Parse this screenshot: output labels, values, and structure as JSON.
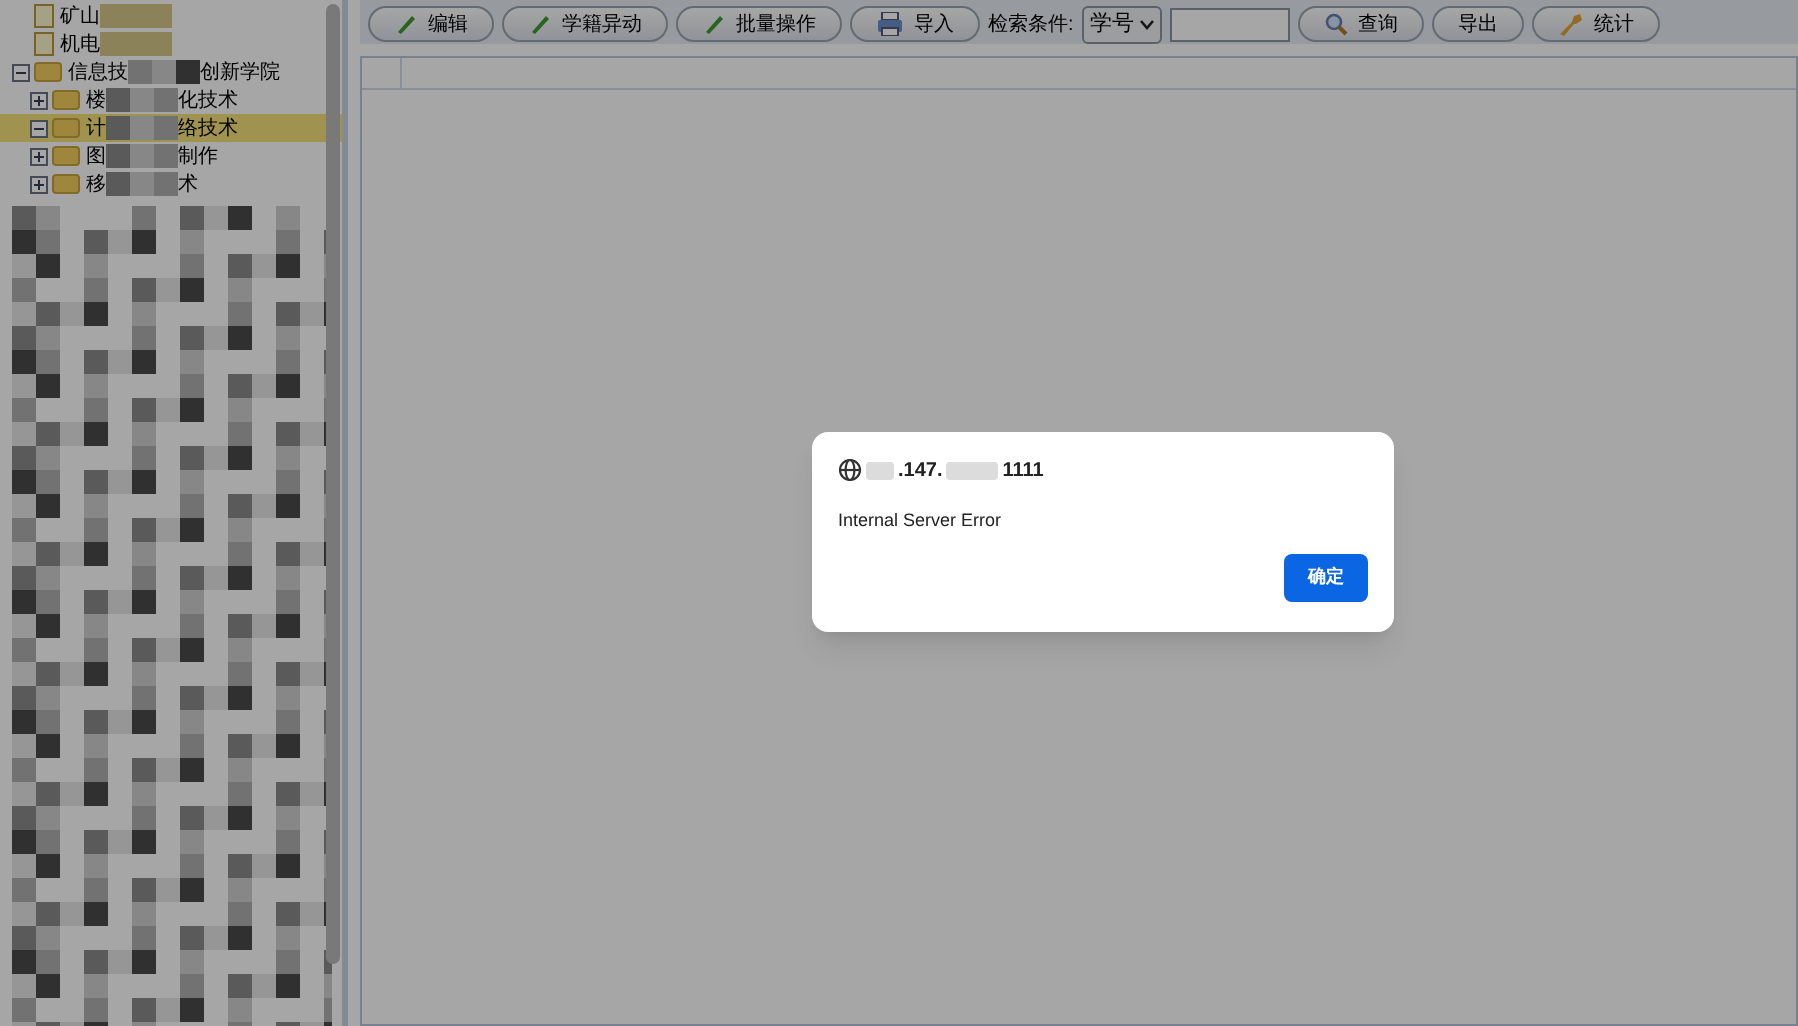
{
  "tree": [
    {
      "kind": "file",
      "parts": [
        "矿山"
      ]
    },
    {
      "kind": "file",
      "parts": [
        "机电"
      ]
    },
    {
      "kind": "folder",
      "parts": [
        "信息技",
        "创新学院"
      ],
      "expanded": true,
      "selected": false,
      "children": [
        {
          "kind": "folder",
          "parts": [
            "楼",
            "化技术"
          ],
          "expanded": false,
          "selected": false
        },
        {
          "kind": "folder",
          "parts": [
            "计",
            "络技术"
          ],
          "expanded": true,
          "selected": true
        },
        {
          "kind": "folder",
          "parts": [
            "图",
            "制作"
          ],
          "expanded": false,
          "selected": false
        },
        {
          "kind": "folder",
          "parts": [
            "移",
            "术"
          ],
          "expanded": false,
          "selected": false
        }
      ]
    }
  ],
  "toolbar": {
    "buttons_left": [
      {
        "kind": "pencil",
        "label": "编辑"
      },
      {
        "kind": "pencil",
        "label": "学籍异动"
      },
      {
        "kind": "pencil",
        "label": "批量操作"
      },
      {
        "kind": "printer",
        "label": "导入"
      }
    ],
    "search_label": "检索条件:",
    "search_select": "学号",
    "buttons_right": [
      {
        "kind": "search",
        "label": "查询"
      },
      {
        "kind": "plain",
        "label": "导出"
      },
      {
        "kind": "key",
        "label": "统计"
      }
    ]
  },
  "dialog": {
    "host_parts": [
      ".147.",
      "1111"
    ],
    "message": "Internal Server Error",
    "button": "确定"
  }
}
